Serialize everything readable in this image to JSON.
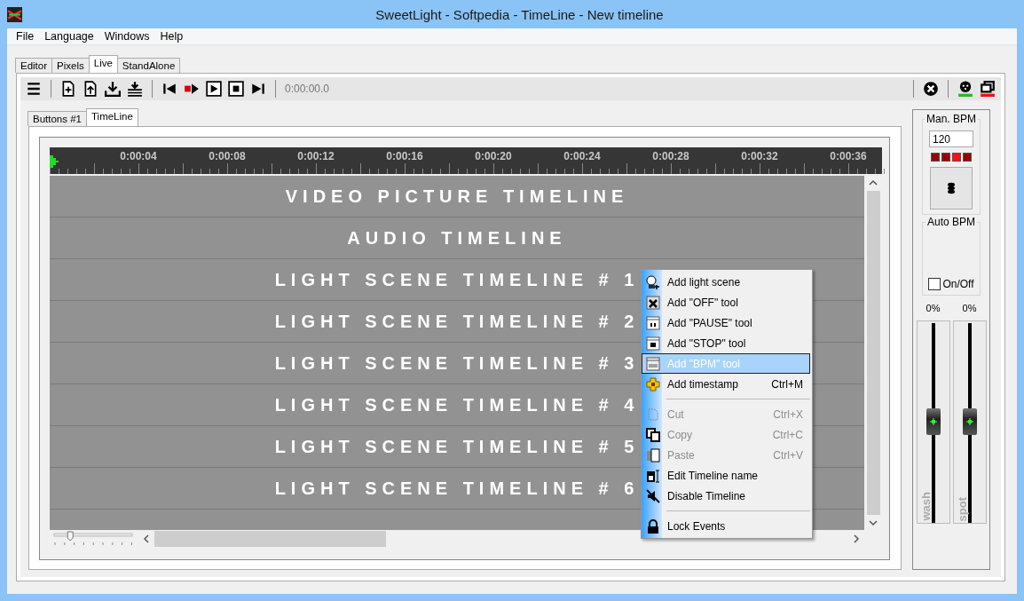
{
  "window": {
    "title": "SweetLight - Softpedia - TimeLine - New timeline"
  },
  "menu": [
    "File",
    "Language",
    "Windows",
    "Help"
  ],
  "tabs": [
    {
      "label": "Editor",
      "selected": false
    },
    {
      "label": "Pixels",
      "selected": false
    },
    {
      "label": "Live",
      "selected": true
    },
    {
      "label": "StandAlone",
      "selected": false
    }
  ],
  "toolbar": {
    "time": "0:00:00.0"
  },
  "subtabs": [
    {
      "label": "Buttons #1",
      "selected": false
    },
    {
      "label": "TimeLine",
      "selected": true
    }
  ],
  "ruler": [
    "0:00:04",
    "0:00:08",
    "0:00:12",
    "0:00:16",
    "0:00:20",
    "0:00:24",
    "0:00:28",
    "0:00:32",
    "0:00:36"
  ],
  "tracks": [
    "VIDEO PICTURE TIMELINE",
    "AUDIO TIMELINE",
    "LIGHT SCENE TIMELINE # 1",
    "LIGHT SCENE TIMELINE # 2",
    "LIGHT SCENE TIMELINE # 3",
    "LIGHT SCENE TIMELINE # 4",
    "LIGHT SCENE TIMELINE # 5",
    "LIGHT SCENE TIMELINE # 6"
  ],
  "zoom": {
    "level": 0.2
  },
  "context_menu": [
    {
      "kind": "item",
      "label": "Add light scene",
      "disabled": false,
      "selected": false
    },
    {
      "kind": "item",
      "label": "Add \"OFF\" tool",
      "disabled": false,
      "selected": false
    },
    {
      "kind": "item",
      "label": "Add \"PAUSE\" tool",
      "disabled": false,
      "selected": false
    },
    {
      "kind": "item",
      "label": "Add \"STOP\" tool",
      "disabled": false,
      "selected": false
    },
    {
      "kind": "item",
      "label": "Add \"BPM\" tool",
      "disabled": false,
      "selected": true
    },
    {
      "kind": "item",
      "label": "Add timestamp",
      "shortcut": "Ctrl+M",
      "disabled": false,
      "selected": false
    },
    {
      "kind": "separator"
    },
    {
      "kind": "item",
      "label": "Cut",
      "shortcut": "Ctrl+X",
      "disabled": true,
      "selected": false
    },
    {
      "kind": "item",
      "label": "Copy",
      "shortcut": "Ctrl+C",
      "disabled": true,
      "selected": false
    },
    {
      "kind": "item",
      "label": "Paste",
      "shortcut": "Ctrl+V",
      "disabled": true,
      "selected": false
    },
    {
      "kind": "item",
      "label": "Edit Timeline name",
      "disabled": false,
      "selected": false
    },
    {
      "kind": "item",
      "label": "Disable Timeline",
      "disabled": false,
      "selected": false
    },
    {
      "kind": "separator"
    },
    {
      "kind": "item",
      "label": "Lock Events",
      "disabled": false,
      "selected": false
    }
  ],
  "bpm": {
    "title": "Man. BPM",
    "value": "120",
    "lights": [
      {
        "on": false
      },
      {
        "on": false
      },
      {
        "on": true
      },
      {
        "on": false
      }
    ]
  },
  "auto_bpm": {
    "title": "Auto BPM",
    "label": "On/Off",
    "checked": false
  },
  "faders": [
    {
      "reading": "0%",
      "name": "wash",
      "level": 0.5
    },
    {
      "reading": "0%",
      "name": "spot",
      "level": 0.5
    }
  ]
}
